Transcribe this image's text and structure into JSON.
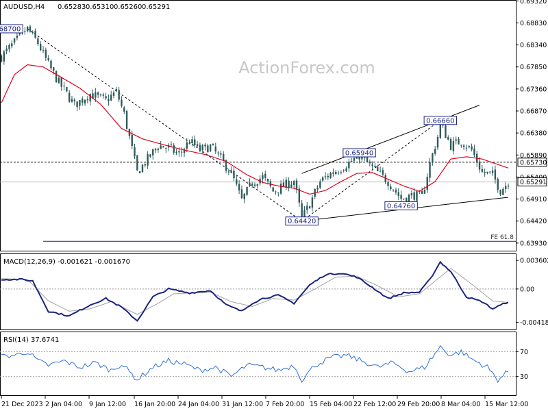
{
  "chart_data": {
    "type": "line",
    "header": {
      "symbol": "AUDUSD,H4",
      "open": "0.65283",
      "high": "0.65310",
      "low": "0.65260",
      "close": "0.65291"
    },
    "watermark": "ActionForex.com",
    "x_tick_labels": [
      "21 Dec 2023",
      "2 Jan 04:00",
      "9 Jan 12:00",
      "16 Jan 20:00",
      "24 Jan 04:00",
      "31 Jan 12:00",
      "7 Feb 20:00",
      "15 Feb 04:00",
      "22 Feb 12:00",
      "29 Feb 20:00",
      "8 Mar 04:00",
      "15 Mar 12:00"
    ],
    "price_panel": {
      "ylim": [
        0.6376,
        0.6934
      ],
      "y_tick_labels": [
        "0.69320",
        "0.68830",
        "0.68340",
        "0.67850",
        "0.67360",
        "0.66870",
        "0.66380",
        "0.65890",
        "0.65400",
        "0.64910",
        "0.64420",
        "0.63930"
      ],
      "current_price_label": "0.65291",
      "current_price": 0.65291,
      "resistance_label": "0.65730",
      "resistance": 0.6573,
      "fe_label": "FE 61.8",
      "fe_level": 0.6397,
      "annotations": [
        {
          "text": "0.68700",
          "i": 2,
          "price": 0.687
        },
        {
          "text": "0.65940",
          "i": 137,
          "price": 0.6594
        },
        {
          "text": "0.66660",
          "i": 168,
          "price": 0.6666
        },
        {
          "text": "0.64420",
          "i": 115,
          "price": 0.6442
        },
        {
          "text": "0.64760",
          "i": 153,
          "price": 0.6476
        }
      ],
      "candles_count": 195,
      "price_path": [
        [
          0,
          0.6808
        ],
        [
          8,
          0.6858
        ],
        [
          10,
          0.687
        ],
        [
          14,
          0.6838
        ],
        [
          18,
          0.679
        ],
        [
          22,
          0.675
        ],
        [
          28,
          0.67
        ],
        [
          34,
          0.6725
        ],
        [
          40,
          0.671
        ],
        [
          44,
          0.673
        ],
        [
          47,
          0.668
        ],
        [
          52,
          0.655
        ],
        [
          56,
          0.658
        ],
        [
          60,
          0.661
        ],
        [
          64,
          0.6605
        ],
        [
          68,
          0.659
        ],
        [
          72,
          0.662
        ],
        [
          76,
          0.66
        ],
        [
          80,
          0.6608
        ],
        [
          84,
          0.658
        ],
        [
          88,
          0.6548
        ],
        [
          92,
          0.6488
        ],
        [
          96,
          0.6528
        ],
        [
          100,
          0.654
        ],
        [
          104,
          0.6508
        ],
        [
          108,
          0.652
        ],
        [
          112,
          0.6532
        ],
        [
          115,
          0.6448
        ],
        [
          118,
          0.648
        ],
        [
          122,
          0.653
        ],
        [
          126,
          0.6548
        ],
        [
          130,
          0.656
        ],
        [
          134,
          0.6575
        ],
        [
          137,
          0.6588
        ],
        [
          142,
          0.656
        ],
        [
          148,
          0.653
        ],
        [
          153,
          0.6492
        ],
        [
          158,
          0.65
        ],
        [
          161,
          0.6495
        ],
        [
          164,
          0.657
        ],
        [
          167,
          0.663
        ],
        [
          168,
          0.666
        ],
        [
          172,
          0.661
        ],
        [
          176,
          0.662
        ],
        [
          180,
          0.66
        ],
        [
          184,
          0.655
        ],
        [
          188,
          0.6545
        ],
        [
          191,
          0.651
        ],
        [
          194,
          0.6529
        ]
      ],
      "ma_path": [
        [
          0,
          0.6705
        ],
        [
          5,
          0.6768
        ],
        [
          10,
          0.679
        ],
        [
          16,
          0.6785
        ],
        [
          22,
          0.6765
        ],
        [
          30,
          0.6738
        ],
        [
          38,
          0.6702
        ],
        [
          46,
          0.6648
        ],
        [
          54,
          0.6625
        ],
        [
          62,
          0.6612
        ],
        [
          70,
          0.66
        ],
        [
          78,
          0.659
        ],
        [
          86,
          0.6575
        ],
        [
          94,
          0.6545
        ],
        [
          100,
          0.6528
        ],
        [
          106,
          0.652
        ],
        [
          112,
          0.6515
        ],
        [
          118,
          0.6502
        ],
        [
          124,
          0.651
        ],
        [
          130,
          0.653
        ],
        [
          136,
          0.6548
        ],
        [
          142,
          0.655
        ],
        [
          148,
          0.6535
        ],
        [
          154,
          0.652
        ],
        [
          160,
          0.6508
        ],
        [
          166,
          0.653
        ],
        [
          172,
          0.658
        ],
        [
          178,
          0.6585
        ],
        [
          184,
          0.658
        ],
        [
          190,
          0.6568
        ],
        [
          194,
          0.656
        ]
      ],
      "lines": [
        {
          "style": "dashed",
          "from": [
            10,
            0.687
          ],
          "to": [
            115,
            0.6442
          ]
        },
        {
          "style": "dashed",
          "from": [
            115,
            0.6442
          ],
          "to": [
            168,
            0.6666
          ]
        },
        {
          "style": "solid",
          "from": [
            115,
            0.6442
          ],
          "to": [
            194,
            0.6495
          ]
        },
        {
          "style": "solid",
          "from": [
            115,
            0.6548
          ],
          "to": [
            183,
            0.67
          ]
        }
      ]
    },
    "macd_panel": {
      "label": "MACD(12,26,9) -0.001621 -0.001670",
      "ylim": [
        -0.0051,
        0.0043
      ],
      "y_tick_labels": [
        "0.003602",
        "0.00",
        "-0.004188"
      ],
      "macd_path": [
        [
          0,
          0.0012
        ],
        [
          8,
          0.0012
        ],
        [
          12,
          0.001
        ],
        [
          18,
          -0.0028
        ],
        [
          26,
          -0.0034
        ],
        [
          34,
          -0.002
        ],
        [
          40,
          -0.0012
        ],
        [
          46,
          -0.0023
        ],
        [
          52,
          -0.004
        ],
        [
          58,
          -0.001
        ],
        [
          64,
          0.0
        ],
        [
          72,
          -0.0005
        ],
        [
          80,
          -0.0002
        ],
        [
          86,
          -0.002
        ],
        [
          92,
          -0.0028
        ],
        [
          96,
          -0.0018
        ],
        [
          100,
          -0.0012
        ],
        [
          106,
          -0.0008
        ],
        [
          112,
          -0.0018
        ],
        [
          118,
          0.0005
        ],
        [
          124,
          0.0018
        ],
        [
          130,
          0.002
        ],
        [
          136,
          0.0015
        ],
        [
          142,
          0.0002
        ],
        [
          148,
          -0.0012
        ],
        [
          154,
          -0.0005
        ],
        [
          160,
          -0.0004
        ],
        [
          164,
          0.0012
        ],
        [
          168,
          0.0034
        ],
        [
          172,
          0.0022
        ],
        [
          178,
          -0.001
        ],
        [
          184,
          -0.0016
        ],
        [
          188,
          -0.0025
        ],
        [
          194,
          -0.0016
        ]
      ],
      "signal_path": [
        [
          0,
          0.0013
        ],
        [
          10,
          0.0012
        ],
        [
          18,
          -0.0015
        ],
        [
          26,
          -0.0028
        ],
        [
          34,
          -0.0025
        ],
        [
          42,
          -0.0016
        ],
        [
          52,
          -0.0032
        ],
        [
          60,
          -0.0018
        ],
        [
          66,
          -0.0006
        ],
        [
          80,
          -0.0004
        ],
        [
          88,
          -0.0016
        ],
        [
          96,
          -0.0022
        ],
        [
          104,
          -0.0012
        ],
        [
          112,
          -0.0014
        ],
        [
          120,
          0.0
        ],
        [
          128,
          0.0015
        ],
        [
          136,
          0.0016
        ],
        [
          144,
          0.0004
        ],
        [
          152,
          -0.001
        ],
        [
          160,
          -0.0006
        ],
        [
          166,
          0.001
        ],
        [
          172,
          0.0026
        ],
        [
          180,
          0.0006
        ],
        [
          188,
          -0.0015
        ],
        [
          194,
          -0.0017
        ]
      ]
    },
    "rsi_panel": {
      "label": "RSI(14) 37.6741",
      "ylim": [
        0,
        100
      ],
      "y_tick_labels": [
        "70",
        "30"
      ],
      "levels": [
        70,
        30
      ],
      "rsi_path": [
        [
          0,
          62
        ],
        [
          6,
          65
        ],
        [
          10,
          70
        ],
        [
          14,
          55
        ],
        [
          18,
          48
        ],
        [
          24,
          55
        ],
        [
          30,
          45
        ],
        [
          36,
          52
        ],
        [
          42,
          40
        ],
        [
          46,
          50
        ],
        [
          52,
          25
        ],
        [
          58,
          45
        ],
        [
          64,
          55
        ],
        [
          70,
          50
        ],
        [
          76,
          40
        ],
        [
          82,
          45
        ],
        [
          88,
          30
        ],
        [
          94,
          48
        ],
        [
          100,
          45
        ],
        [
          106,
          40
        ],
        [
          112,
          48
        ],
        [
          115,
          25
        ],
        [
          120,
          48
        ],
        [
          126,
          60
        ],
        [
          132,
          64
        ],
        [
          138,
          55
        ],
        [
          144,
          45
        ],
        [
          150,
          52
        ],
        [
          156,
          38
        ],
        [
          162,
          45
        ],
        [
          168,
          78
        ],
        [
          172,
          64
        ],
        [
          176,
          70
        ],
        [
          180,
          58
        ],
        [
          186,
          45
        ],
        [
          190,
          25
        ],
        [
          194,
          38
        ]
      ]
    }
  }
}
